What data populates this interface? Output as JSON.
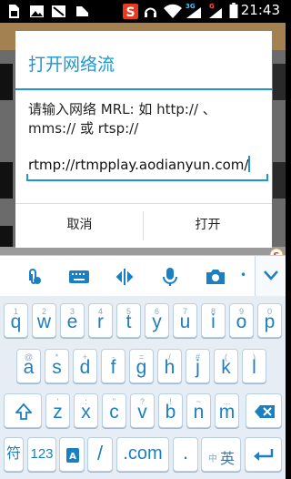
{
  "status_bar": {
    "time": "21:43",
    "net_3g": "3G",
    "net_g": "G"
  },
  "dialog": {
    "title": "打开网络流",
    "message": "请输入网络 MRL: 如 http:// 、mms:// 或 rtsp://",
    "input_value": "rtmp://rtmpplay.aodianyun.com/",
    "cancel_label": "取消",
    "open_label": "打开"
  },
  "keyboard": {
    "row1": [
      {
        "main": "q",
        "sub": "1"
      },
      {
        "main": "w",
        "sub": "2"
      },
      {
        "main": "e",
        "sub": "3"
      },
      {
        "main": "r",
        "sub": "4"
      },
      {
        "main": "t",
        "sub": "5"
      },
      {
        "main": "y",
        "sub": "6"
      },
      {
        "main": "u",
        "sub": "7"
      },
      {
        "main": "i",
        "sub": "8"
      },
      {
        "main": "o",
        "sub": "9"
      },
      {
        "main": "p",
        "sub": "0"
      }
    ],
    "row2": [
      {
        "main": "a",
        "sub": "@"
      },
      {
        "main": "s",
        "sub": "*"
      },
      {
        "main": "d",
        "sub": "+"
      },
      {
        "main": "f",
        "sub": "-"
      },
      {
        "main": "g",
        "sub": "="
      },
      {
        "main": "h",
        "sub": "/"
      },
      {
        "main": "j",
        "sub": "#"
      },
      {
        "main": "k",
        "sub": "("
      },
      {
        "main": "l",
        "sub": ")"
      }
    ],
    "row3": [
      {
        "main": "z",
        "sub": "'"
      },
      {
        "main": "x",
        "sub": ":"
      },
      {
        "main": "c",
        "sub": "\""
      },
      {
        "main": "v",
        "sub": "?"
      },
      {
        "main": "b",
        "sub": "!"
      },
      {
        "main": "n",
        "sub": "~"
      },
      {
        "main": "m",
        "sub": "..."
      }
    ],
    "symbol_label": "符",
    "num_label": "123",
    "slash_label": "/",
    "com_label": ".com",
    "dot_label": ".",
    "lang_small": "中",
    "lang_big": "英"
  },
  "colors": {
    "accent": "#1a97d4",
    "key_text": "#1c7fc2",
    "keyboard_bg": "#e6edf4"
  }
}
